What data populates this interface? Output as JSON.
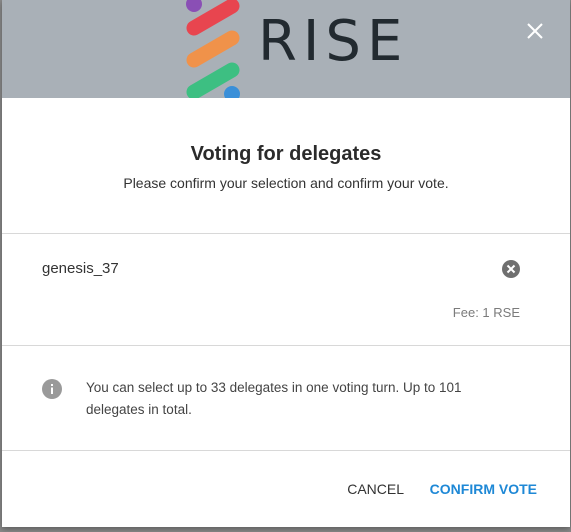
{
  "header": {
    "logo_text": "RISE",
    "colors": {
      "header_bg": "#a9b0b7",
      "stripe_red": "#e8454f",
      "stripe_orange": "#f0924a",
      "stripe_green": "#3dbf82",
      "dot_purple": "#8a4fb5",
      "dot_blue": "#3a8fd8"
    },
    "close_icon": "close-icon"
  },
  "dialog": {
    "title": "Voting for delegates",
    "subtitle": "Please confirm your selection and confirm your vote."
  },
  "delegate": {
    "name": "genesis_37",
    "remove_icon": "remove-circle-icon",
    "fee": "Fee: 1 RSE"
  },
  "info": {
    "icon": "info-icon",
    "text": "You can select up to 33 delegates in one voting turn. Up to 101 delegates in total."
  },
  "actions": {
    "cancel_label": "CANCEL",
    "confirm_label": "CONFIRM VOTE",
    "accent_color": "#1e88d6"
  }
}
